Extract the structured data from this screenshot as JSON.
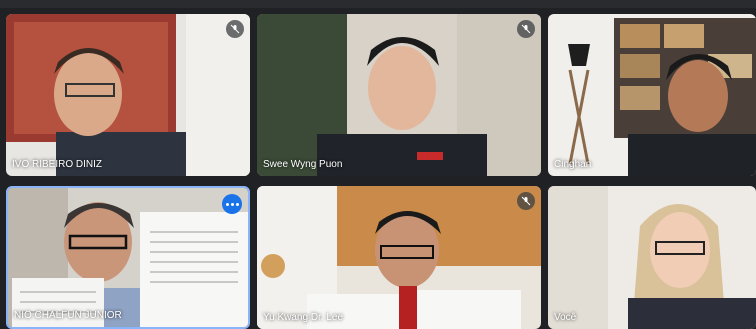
{
  "participants": [
    {
      "name": "IVO RIBEIRO DINIZ",
      "muted": true
    },
    {
      "name": "Swee Wyng Puon",
      "muted": true
    },
    {
      "name": "Cinghan",
      "muted": false
    },
    {
      "name": "NIO CHALFUN JUNIOR",
      "muted": false,
      "active_speaker": true
    },
    {
      "name": "Yu Kwang Dr. Lee",
      "muted": true
    },
    {
      "name": "Você",
      "muted": false
    }
  ],
  "icons": {
    "mute": "mic-off-icon",
    "more": "more-options-icon"
  },
  "colors": {
    "background": "#202124",
    "active_border": "#8ab4f8",
    "more_button": "#1a73e8"
  }
}
